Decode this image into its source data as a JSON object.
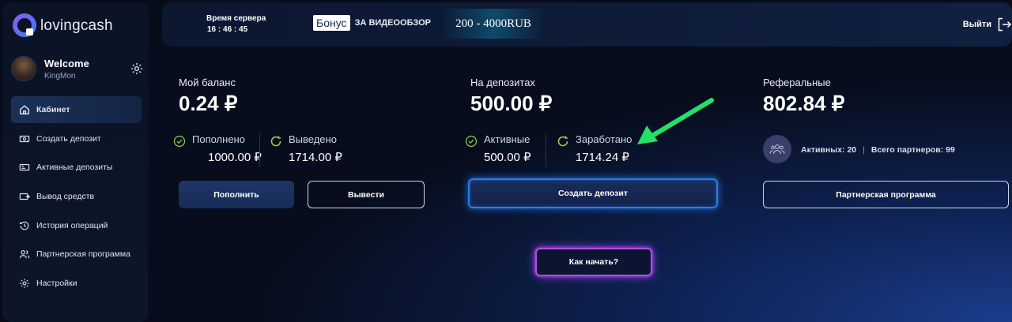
{
  "brand": {
    "name": "lovingcash"
  },
  "user": {
    "welcome": "Welcome",
    "name": "KingMon"
  },
  "sidebar": {
    "items": [
      {
        "label": "Кабинет",
        "icon": "home-icon",
        "active": true
      },
      {
        "label": "Создать депозит",
        "icon": "deposit-create-icon",
        "active": false
      },
      {
        "label": "Активные депозиты",
        "icon": "active-deposits-icon",
        "active": false
      },
      {
        "label": "Вывод средств",
        "icon": "withdraw-icon",
        "active": false
      },
      {
        "label": "История операций",
        "icon": "history-icon",
        "active": false
      },
      {
        "label": "Партнерская программа",
        "icon": "partners-icon",
        "active": false
      },
      {
        "label": "Настройки",
        "icon": "settings-icon",
        "active": false
      }
    ]
  },
  "header": {
    "server_time_label": "Время сервера",
    "server_time_value": "16 : 46 : 45",
    "bonus_badge": "Бонус",
    "bonus_text": "ЗА ВИДЕООБЗОР",
    "bonus_amount": "200 - 4000RUB",
    "logout_label": "Выйти"
  },
  "balance": {
    "title": "Мой баланс",
    "amount": "0.24 ₽",
    "deposited_label": "Пополнено",
    "deposited_value": "1000.00 ₽",
    "withdrawn_label": "Выведено",
    "withdrawn_value": "1714.00 ₽",
    "topup_button": "Пополнить",
    "withdraw_button": "Вывести"
  },
  "deposits": {
    "title": "На депозитах",
    "amount": "500.00 ₽",
    "active_label": "Активные",
    "active_value": "500.00 ₽",
    "earned_label": "Заработано",
    "earned_value": "1714.24 ₽",
    "create_button": "Создать депозит"
  },
  "referrals": {
    "title": "Реферальные",
    "amount": "802.84 ₽",
    "active_text": "Активных: 20",
    "separator": "|",
    "total_text": "Всего партнеров: 99",
    "program_button": "Партнерская программа"
  },
  "how_to_start_button": "Как начать?",
  "colors": {
    "accent_green": "#8fd14f",
    "arrow_green": "#22e06a",
    "glow_blue": "#2f7de0",
    "glow_purple": "#b54ce0"
  }
}
